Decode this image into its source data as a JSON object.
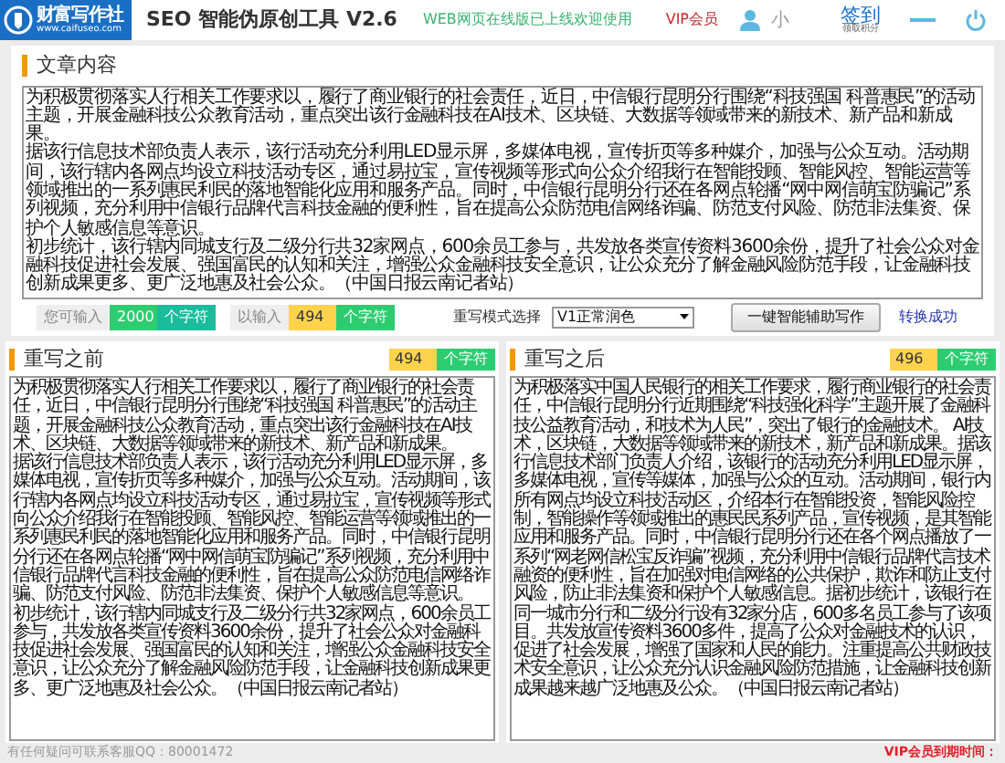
{
  "header": {
    "logo_name": "财富写作社",
    "logo_url": "www.caifuseo.com",
    "title": "SEO 智能伪原创工具 V2.6",
    "notice": "WEB网页在线版已上线欢迎使用",
    "vip": "VIP会员",
    "username": "小",
    "checkin": "签到",
    "checkin_sub": "领取积分"
  },
  "article": {
    "title": "文章内容",
    "paragraphs": [
      "为积极贯彻落实人行相关工作要求以，履行了商业银行的社会责任，近日，中信银行昆明分行围绕“科技强国 科普惠民”的活动主题，开展金融科技公众教育活动，重点突出该行金融科技在AI技术、区块链、大数据等领域带来的新技术、新产品和新成果。",
      "据该行信息技术部负责人表示，该行活动充分利用LED显示屏，多媒体电视，宣传折页等多种媒介，加强与公众互动。活动期间，该行辖内各网点均设立科技活动专区，通过易拉宝，宣传视频等形式向公众介绍我行在智能投顾、智能风控、智能运营等领域推出的一系列惠民利民的落地智能化应用和服务产品。同时，中信银行昆明分行还在各网点轮播“网中网信萌宝防骗记”系列视频，充分利用中信银行品牌代言科技金融的便利性，旨在提高公众防范电信网络诈骗、防范支付风险、防范非法集资、保护个人敏感信息等意识。",
      "初步统计，该行辖内同城支行及二级分行共32家网点，600余员工参与，共发放各类宣传资料3600余份，提升了社会公众对金融科技促进社会发展、强国富民的认知和关注，增强公众金融科技安全意识，让公众充分了解金融风险防范手段，让金融科技创新成果更多、更广泛地惠及社会公众。（中国日报云南记者站）"
    ]
  },
  "stats": {
    "allowed_label": "您可输入",
    "allowed": "2000",
    "allowed_unit": "个字符",
    "entered_label": "以输入",
    "entered": "494",
    "entered_unit": "个字符",
    "mode_label": "重写模式选择",
    "mode": "V1正常润色",
    "button": "一键智能辅助写作",
    "status": "转换成功"
  },
  "panels": [
    {
      "title": "重写之前",
      "count": "494",
      "unit": "个字符",
      "paragraphs": [
        "为积极贯彻落实人行相关工作要求以，履行了商业银行的社会责任，近日，中信银行昆明分行围绕“科技强国 科普惠民”的活动主题，开展金融科技公众教育活动，重点突出该行金融科技在AI技术、区块链、大数据等领域带来的新技术、新产品和新成果。",
        "据该行信息技术部负责人表示，该行活动充分利用LED显示屏，多媒体电视，宣传折页等多种媒介，加强与公众互动。活动期间，该行辖内各网点均设立科技活动专区，通过易拉宝，宣传视频等形式向公众介绍我行在智能投顾、智能风控、智能运营等领域推出的一系列惠民利民的落地智能化应用和服务产品。同时，中信银行昆明分行还在各网点轮播“网中网信萌宝防骗记”系列视频，充分利用中信银行品牌代言科技金融的便利性，旨在提高公众防范电信网络诈骗、防范支付风险、防范非法集资、保护个人敏感信息等意识。",
        "初步统计，该行辖内同城支行及二级分行共32家网点，600余员工参与，共发放各类宣传资料3600余份，提升了社会公众对金融科技促进社会发展、强国富民的认知和关注，增强公众金融科技安全意识，让公众充分了解金融风险防范手段，让金融科技创新成果更多、更广泛地惠及社会公众。（中国日报云南记者站）"
      ]
    },
    {
      "title": "重写之后",
      "count": "496",
      "unit": "个字符",
      "paragraphs": [
        "为积极落实中国人民银行的相关工作要求，履行商业银行的社会责任，中信银行昆明分行近期围绕“科技强化科学”主题开展了金融科技公益教育活动，和技术为人民”，突出了银行的金融技术。 AI技术，区块链，大数据等领域带来的新技术，新产品和新成果。据该行信息技术部门负责人介绍，该银行的活动充分利用LED显示屏，多媒体电视，宣传等媒体，加强与公众的互动。活动期间，银行内所有网点均设立科技活动区，介绍本行在智能投资，智能风险控制，智能操作等领域推出的惠民民系列产品，宣传视频，是其智能应用和服务产品。同时，中信银行昆明分行还在各个网点播放了一系列“网老网信松宝反诈骗”视频，充分利用中信银行品牌代言技术融资的便利性，旨在加强对电信网络的公共保护，欺诈和防止支付风险，防止非法集资和保护个人敏感信息。据初步统计，该银行在同一城市分行和二级分行设有32家分店，600多名员工参与了该项目。共发放宣传资料3600多件，提高了公众对金融技术的认识，促进了社会发展，增强了国家和人民的能力。注重提高公共财政技术安全意识，让公众充分认识金融风险防范措施，让金融科技创新成果越来越广泛地惠及公众。（中国日报云南记者站）"
      ]
    }
  ],
  "footer": {
    "contact": "有任何疑问可联系客服QQ：80001472",
    "vip_expiry": "VIP会员到期时间："
  }
}
